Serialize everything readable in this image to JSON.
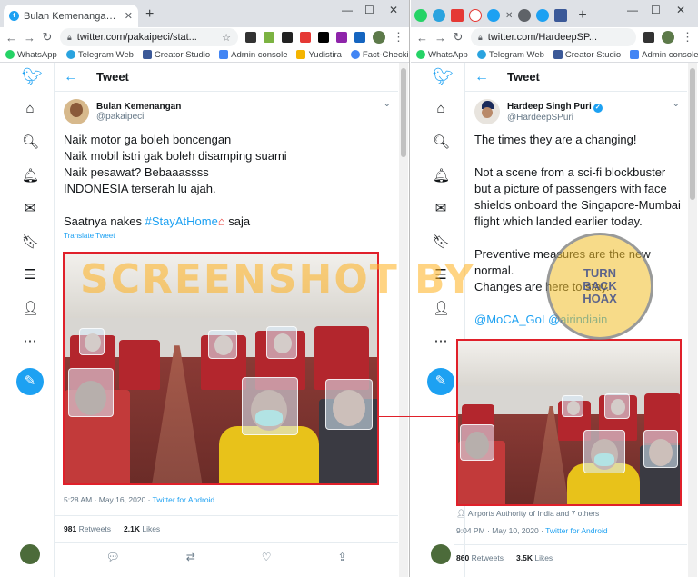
{
  "left": {
    "tab_title": "Bulan Kemenangan on Twitter: \"N",
    "url": "twitter.com/pakaipeci/stat...",
    "bookmarks": [
      "WhatsApp",
      "Telegram Web",
      "Creator Studio",
      "Admin console",
      "Yudistira",
      "Fact-Checking"
    ],
    "header_title": "Tweet",
    "author_name": "Bulan Kemenangan",
    "author_handle": "@pakaipeci",
    "text_lines": [
      "Naik motor ga boleh boncengan",
      "Naik mobil istri gak boleh disamping suami",
      "Naik pesawat? Bebaaassss",
      "INDONESIA  terserah lu ajah."
    ],
    "text_line5_prefix": "Saatnya nakes ",
    "hashtag": "#StayAtHome",
    "text_line5_suffix": " saja",
    "translate": "Translate Tweet",
    "timestamp": "5:28 AM · May 16, 2020 · ",
    "source": "Twitter for Android",
    "retweets": "981",
    "retweets_label": "Retweets",
    "likes": "2.1K",
    "likes_label": "Likes"
  },
  "right": {
    "tab_title": "",
    "url": "twitter.com/HardeepSP...",
    "bookmarks": [
      "WhatsApp",
      "Telegram Web",
      "Creator Studio",
      "Admin console"
    ],
    "header_title": "Tweet",
    "author_name": "Hardeep Singh Puri",
    "author_handle": "@HardeepSPuri",
    "p1": "The times they are a changing!",
    "p2_lines": [
      "Not a scene from a sci-fi blockbuster",
      "but a picture of passengers with face",
      "shields onboard the Singapore-Mumbai",
      "flight which landed earlier today."
    ],
    "p3_lines": [
      "Preventive measures are the new",
      "normal.",
      "Changes are here to stay."
    ],
    "mentions": "@MoCA_GoI @airindiain",
    "tagged": "Airports Authority of India and 7 others",
    "timestamp": "9:04 PM · May 10, 2020 · ",
    "source": "Twitter for Android",
    "retweets": "860",
    "retweets_label": "Retweets",
    "likes": "3.5K",
    "likes_label": "Likes"
  },
  "watermark": "SCREENSHOT BY",
  "badge": {
    "line1": "TURN",
    "line2": "BACK",
    "line3": "HOAX"
  },
  "colors": {
    "twitter_blue": "#1da1f2",
    "highlight_red": "#e0202a",
    "watermark_orange": "#ffb01e"
  }
}
